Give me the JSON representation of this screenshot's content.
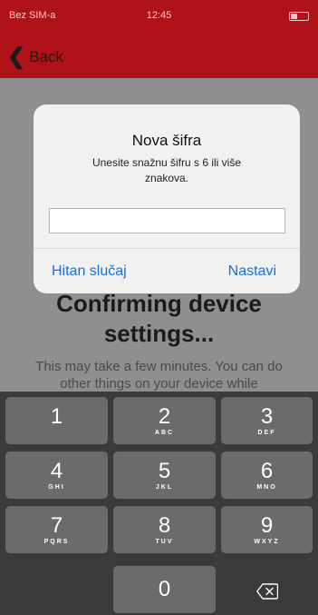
{
  "status_bar": {
    "carrier": "Bez SIM-a",
    "time": "12:45"
  },
  "nav": {
    "back_label": "Back"
  },
  "content": {
    "title": "Confirming device settings...",
    "body": "This may take a few minutes. You can do other things on your device while"
  },
  "alert": {
    "title": "Nova šifra",
    "message": "Unesite snažnu šifru s 6 ili više znakova.",
    "input_value": "",
    "cancel_label": "Hitan slučaj",
    "confirm_label": "Nastavi"
  },
  "keypad": {
    "keys": [
      {
        "digit": "1",
        "letters": ""
      },
      {
        "digit": "2",
        "letters": "ABC"
      },
      {
        "digit": "3",
        "letters": "DEF"
      },
      {
        "digit": "4",
        "letters": "GHI"
      },
      {
        "digit": "5",
        "letters": "JKL"
      },
      {
        "digit": "6",
        "letters": "MNO"
      },
      {
        "digit": "7",
        "letters": "PQRS"
      },
      {
        "digit": "8",
        "letters": "TUV"
      },
      {
        "digit": "9",
        "letters": "WXYZ"
      },
      {
        "digit": "0",
        "letters": ""
      }
    ],
    "delete_icon": "backspace-icon"
  },
  "colors": {
    "nav_red": "#b01219",
    "link_blue": "#1a6fd9",
    "key_gray": "#6b6b6b",
    "keypad_bg": "#3b3b3b"
  }
}
